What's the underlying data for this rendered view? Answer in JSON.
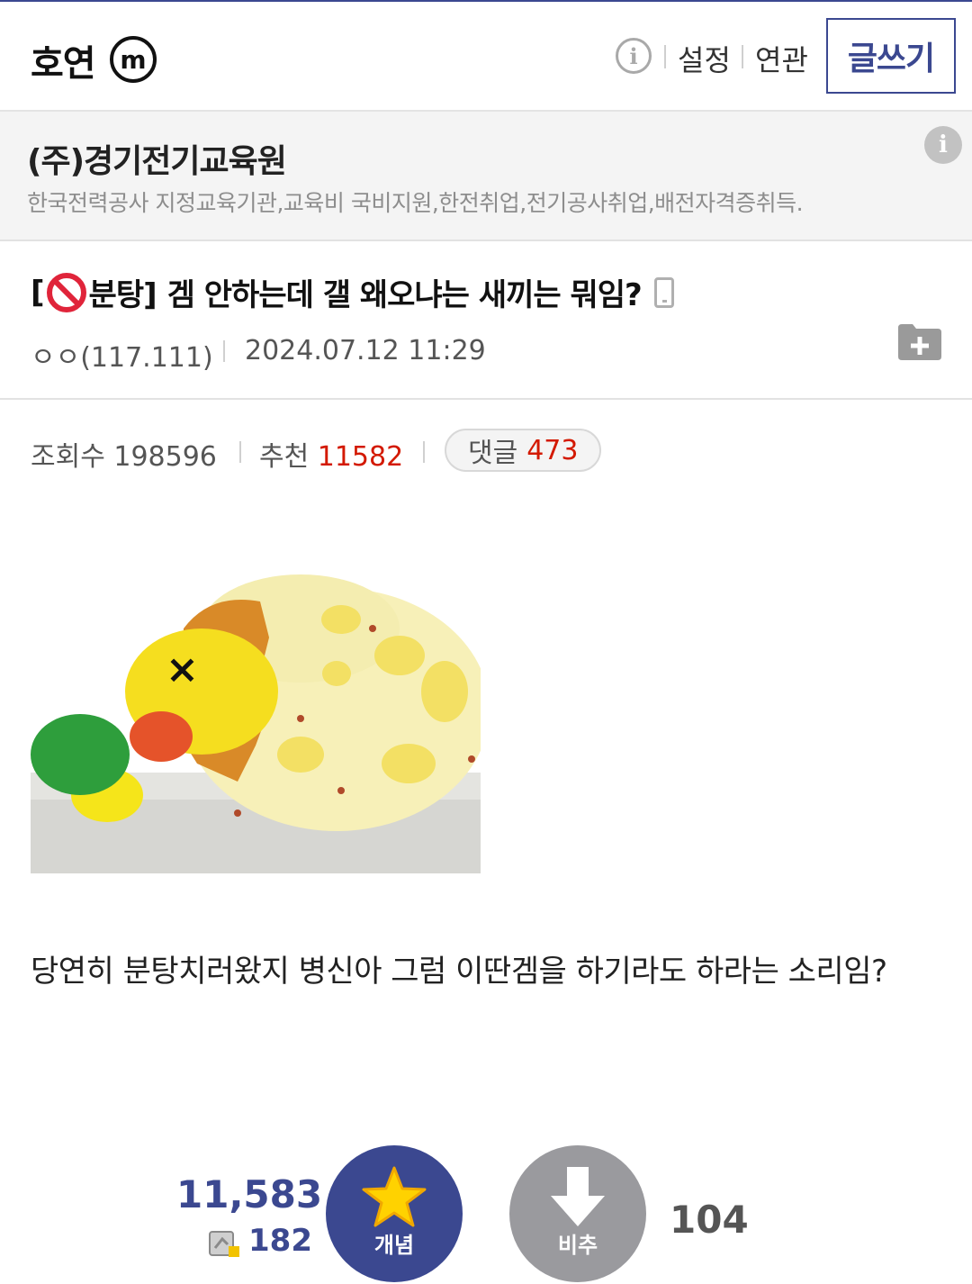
{
  "header": {
    "gallery_name": "호연",
    "minor_badge": "m",
    "info_icon": "i",
    "settings_label": "설정",
    "related_label": "연관",
    "write_label": "글쓰기"
  },
  "ad": {
    "title": "(주)경기전기교육원",
    "description": "한국전력공사 지정교육기관,교육비 국비지원,한전취업,전기공사취업,배전자격증취득.",
    "info_icon": "i"
  },
  "post": {
    "title_prefix_open": "[",
    "title_prefix_close": "분탕]",
    "title": "겜 안하는데 갤 왜오냐는 새끼는 뭐임?",
    "author": "ㅇㅇ(117.111)",
    "date": "2024.07.12 11:29",
    "body": "당연히 분탕치러왔지 병신아 그럼 이딴겜을 하기라도 하라는 소리임?"
  },
  "stats": {
    "views_label": "조회수",
    "views": "198596",
    "recommend_label": "추천",
    "recommend": "11582",
    "comment_label": "댓글",
    "comments": "473"
  },
  "votes": {
    "up_count": "11,583",
    "fixed_count": "182",
    "up_label": "개념",
    "down_label": "비추",
    "down_count": "104"
  },
  "colors": {
    "brand": "#3b4890",
    "accent_red": "#d31900",
    "downvote": "#9a9a9e"
  }
}
